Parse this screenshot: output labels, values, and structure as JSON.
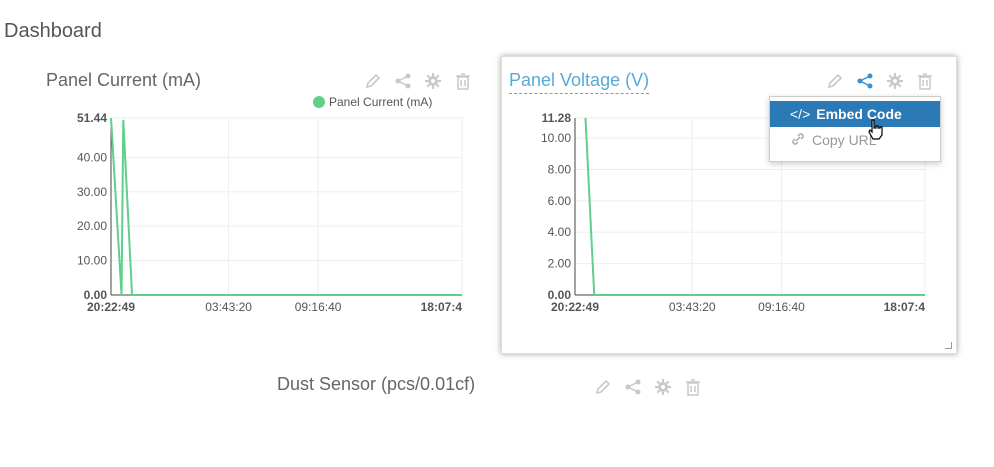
{
  "page": {
    "title": "Dashboard"
  },
  "colors": {
    "series": "#5fcf8a",
    "active_title": "#5aa8d8",
    "menu_highlight": "#2b7ab5",
    "icon": "#c8c8c8",
    "icon_active": "#3b8fd0"
  },
  "panels": [
    {
      "title": "Panel Current (mA)",
      "icons": [
        "pencil-icon",
        "share-icon",
        "gear-icon",
        "trash-icon"
      ],
      "legend": "Panel Current (mA)",
      "chart_data": {
        "type": "line",
        "series": [
          {
            "name": "Panel Current (mA)",
            "values": [
              51.44,
              0.0,
              50.9,
              0.0,
              0.0,
              0.0,
              0.0
            ]
          }
        ],
        "y_ticks": [
          "51.44",
          "40.00",
          "30.00",
          "20.00",
          "10.00",
          "0.00"
        ],
        "x_ticks": [
          "20:22:49",
          "03:43:20",
          "09:16:40",
          "18:07:4"
        ],
        "ylim": [
          0,
          51.44
        ],
        "grid": true
      }
    },
    {
      "title": "Panel Voltage (V)",
      "icons": [
        "pencil-icon",
        "share-icon",
        "gear-icon",
        "trash-icon"
      ],
      "chart_data": {
        "type": "line",
        "series": [
          {
            "values": [
              11.28,
              0.0,
              0.0,
              0.0,
              0.0
            ]
          }
        ],
        "y_ticks": [
          "11.28",
          "10.00",
          "8.00",
          "6.00",
          "4.00",
          "2.00",
          "0.00"
        ],
        "x_ticks": [
          "20:22:49",
          "03:43:20",
          "09:16:40",
          "18:07:4"
        ],
        "ylim": [
          0,
          11.28
        ],
        "grid": true
      }
    },
    {
      "title": "Dust Sensor (pcs/0.01cf)",
      "icons": [
        "pencil-icon",
        "share-icon",
        "gear-icon",
        "trash-icon"
      ]
    }
  ],
  "share_menu": {
    "items": [
      {
        "icon": "</>",
        "label": "Embed Code"
      },
      {
        "icon": "link-icon",
        "label": "Copy URL"
      }
    ]
  }
}
